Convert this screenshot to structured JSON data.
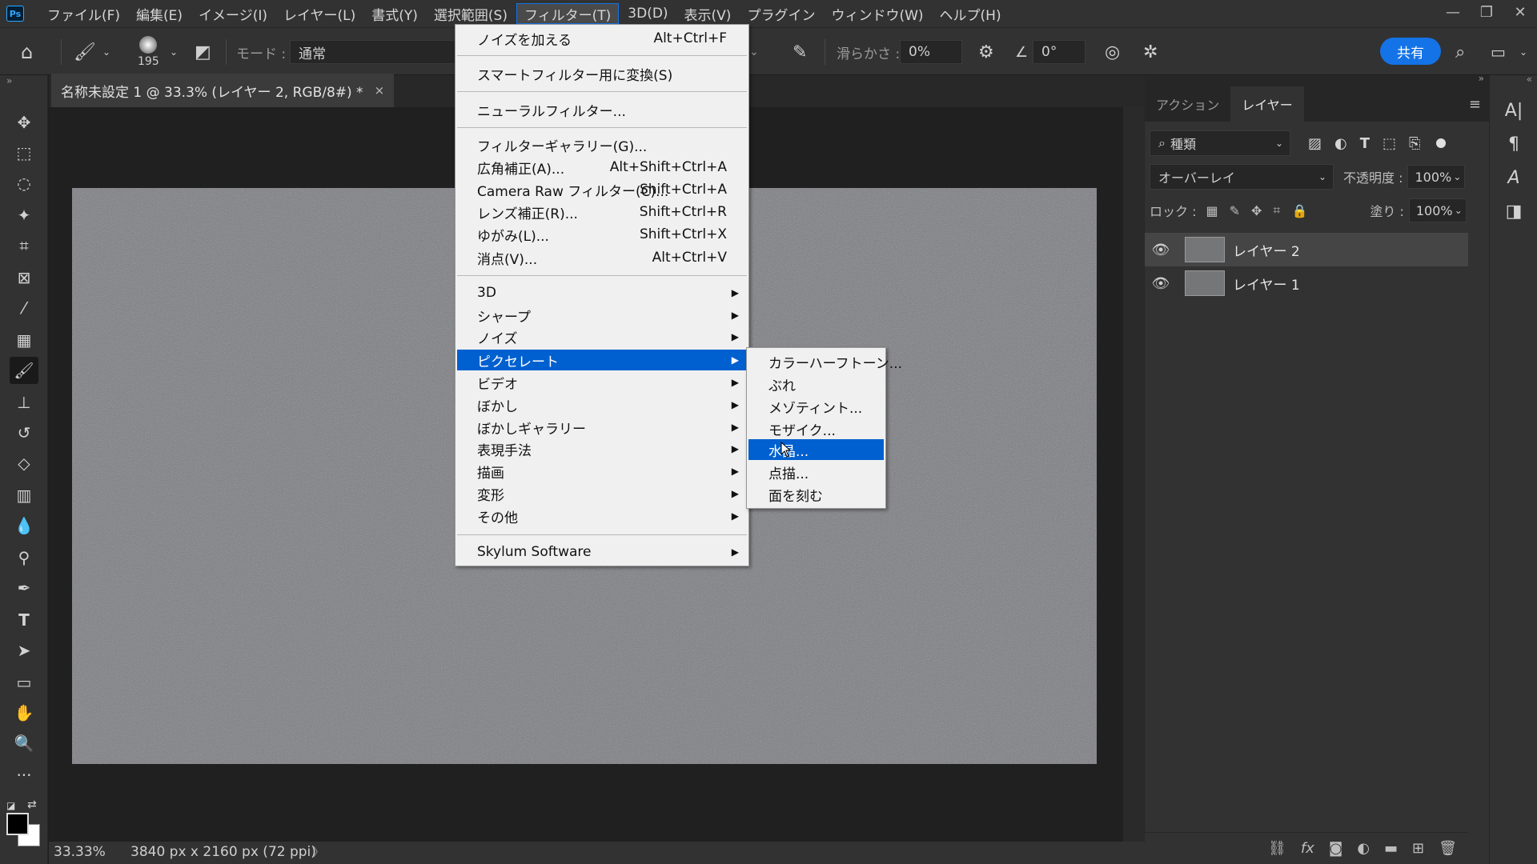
{
  "menubar": {
    "logo": "Ps",
    "items": [
      "ファイル(F)",
      "編集(E)",
      "イメージ(I)",
      "レイヤー(L)",
      "書式(Y)",
      "選択範囲(S)",
      "フィルター(T)",
      "3D(D)",
      "表示(V)",
      "プラグイン",
      "ウィンドウ(W)",
      "ヘルプ(H)"
    ],
    "active_index": 6
  },
  "options": {
    "brush_size": "195",
    "mode_label": "モード :",
    "mode_value": "通常",
    "smoothing_label": "滑らかさ :",
    "smoothing_value": "0%",
    "angle_value": "0°",
    "share_label": "共有"
  },
  "document": {
    "tab_title": "名称未設定 1 @ 33.3% (レイヤー 2, RGB/8#) *",
    "close_glyph": "×",
    "zoom": "33.33%",
    "dimensions": "3840 px x 2160 px (72 ppi)",
    "status_arrow": "〉"
  },
  "panel": {
    "tabs": [
      "アクション",
      "レイヤー"
    ],
    "active_tab": 1,
    "filter_kind": "種類",
    "blend_mode": "オーバーレイ",
    "opacity_label": "不透明度 :",
    "opacity_value": "100%",
    "lock_label": "ロック :",
    "fill_label": "塗り :",
    "fill_value": "100%",
    "layers": [
      {
        "name": "レイヤー 2",
        "selected": true
      },
      {
        "name": "レイヤー 1",
        "selected": false
      }
    ]
  },
  "filter_menu": {
    "items": [
      {
        "label": "ノイズを加える",
        "shortcut": "Alt+Ctrl+F"
      },
      {
        "label": "スマートフィルター用に変換(S)",
        "shortcut": ""
      },
      {
        "label": "ニューラルフィルター...",
        "shortcut": ""
      },
      {
        "label": "フィルターギャラリー(G)...",
        "shortcut": ""
      },
      {
        "label": "広角補正(A)...",
        "shortcut": "Alt+Shift+Ctrl+A"
      },
      {
        "label": "Camera Raw フィルター(C)...",
        "shortcut": "Shift+Ctrl+A"
      },
      {
        "label": "レンズ補正(R)...",
        "shortcut": "Shift+Ctrl+R"
      },
      {
        "label": "ゆがみ(L)...",
        "shortcut": "Shift+Ctrl+X"
      },
      {
        "label": "消点(V)...",
        "shortcut": "Alt+Ctrl+V"
      },
      {
        "label": "3D",
        "shortcut": ""
      },
      {
        "label": "シャープ",
        "shortcut": ""
      },
      {
        "label": "ノイズ",
        "shortcut": ""
      },
      {
        "label": "ピクセレート",
        "shortcut": ""
      },
      {
        "label": "ビデオ",
        "shortcut": ""
      },
      {
        "label": "ぼかし",
        "shortcut": ""
      },
      {
        "label": "ぼかしギャラリー",
        "shortcut": ""
      },
      {
        "label": "表現手法",
        "shortcut": ""
      },
      {
        "label": "描画",
        "shortcut": ""
      },
      {
        "label": "変形",
        "shortcut": ""
      },
      {
        "label": "その他",
        "shortcut": ""
      },
      {
        "label": "Skylum Software",
        "shortcut": ""
      }
    ]
  },
  "pixelate_menu": {
    "items": [
      "カラーハーフトーン...",
      "ぶれ",
      "メゾティント...",
      "モザイク...",
      "水晶...",
      "点描...",
      "面を刻む"
    ],
    "highlighted_index": 4
  },
  "colors": {
    "accent": "#1473e6",
    "menu_highlight": "#0060d0",
    "canvas_gray": "#7a7b80"
  }
}
